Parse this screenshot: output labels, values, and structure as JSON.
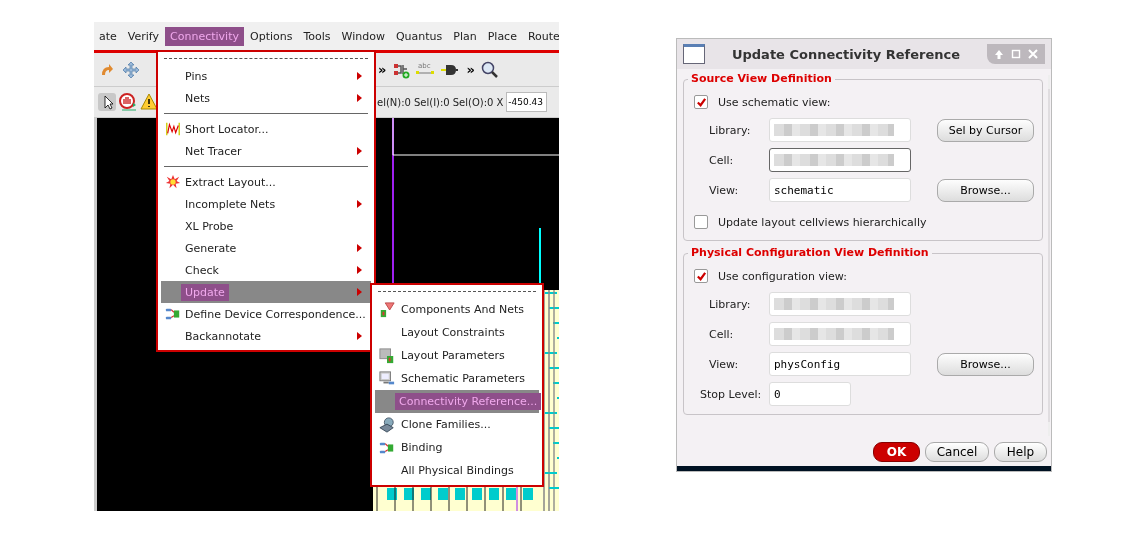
{
  "layout_window": {
    "menu_bar": [
      {
        "label": "ate",
        "selected": false
      },
      {
        "label": "Verify",
        "selected": false
      },
      {
        "label": "Connectivity",
        "selected": true
      },
      {
        "label": "Options",
        "selected": false
      },
      {
        "label": "Tools",
        "selected": false
      },
      {
        "label": "Window",
        "selected": false
      },
      {
        "label": "Quantus",
        "selected": false
      },
      {
        "label": "Plan",
        "selected": false
      },
      {
        "label": "Place",
        "selected": false
      },
      {
        "label": "Route",
        "selected": false
      }
    ],
    "toolbar_1": [
      {
        "kind": "icon"
      },
      {
        "kind": "icon"
      },
      {
        "kind": "more",
        "text": "»"
      },
      {
        "kind": "icon"
      },
      {
        "kind": "icon",
        "text": "abc"
      },
      {
        "kind": "icon"
      },
      {
        "kind": "more",
        "text": "»"
      },
      {
        "kind": "icon"
      }
    ],
    "toolbar_2": [
      {
        "kind": "icon"
      },
      {
        "kind": "icon"
      },
      {
        "kind": "icon"
      },
      {
        "kind": "text",
        "text": "el(N):0"
      },
      {
        "kind": "text",
        "text": "Sel(I):0"
      },
      {
        "kind": "text",
        "text": "Sel(O):0"
      },
      {
        "kind": "text",
        "text": "X"
      },
      {
        "kind": "field",
        "value": "-450.43"
      }
    ],
    "menu": [
      {
        "kind": "tearoff"
      },
      {
        "kind": "item",
        "label": "Pins",
        "submenu": true,
        "selected": false
      },
      {
        "kind": "item",
        "label": "Nets",
        "submenu": true,
        "selected": false
      },
      {
        "kind": "separator"
      },
      {
        "kind": "item",
        "label": "Short Locator...",
        "submenu": false,
        "selected": false
      },
      {
        "kind": "item",
        "label": "Net Tracer",
        "submenu": true,
        "selected": false
      },
      {
        "kind": "separator"
      },
      {
        "kind": "item",
        "label": "Extract Layout...",
        "submenu": false,
        "selected": false
      },
      {
        "kind": "item",
        "label": "Incomplete Nets",
        "submenu": true,
        "selected": false
      },
      {
        "kind": "item",
        "label": "XL Probe",
        "submenu": false,
        "selected": false
      },
      {
        "kind": "item",
        "label": "Generate",
        "submenu": true,
        "selected": false
      },
      {
        "kind": "item",
        "label": "Check",
        "submenu": true,
        "selected": false
      },
      {
        "kind": "item",
        "label": "Update",
        "submenu": true,
        "selected": true
      },
      {
        "kind": "item",
        "label": "Define Device Correspondence...",
        "submenu": false,
        "selected": false
      },
      {
        "kind": "item",
        "label": "Backannotate",
        "submenu": true,
        "selected": false
      }
    ],
    "submenu": [
      {
        "kind": "tearoff"
      },
      {
        "kind": "item",
        "label": "Components And Nets",
        "submenu": false,
        "selected": false
      },
      {
        "kind": "item",
        "label": "Layout Constraints",
        "submenu": false,
        "selected": false
      },
      {
        "kind": "item",
        "label": "Layout Parameters",
        "submenu": false,
        "selected": false
      },
      {
        "kind": "item",
        "label": "Schematic Parameters",
        "submenu": false,
        "selected": false
      },
      {
        "kind": "item",
        "label": "Connectivity Reference...",
        "submenu": false,
        "selected": true
      },
      {
        "kind": "item",
        "label": "Clone Families...",
        "submenu": false,
        "selected": false
      },
      {
        "kind": "item",
        "label": "Binding",
        "submenu": false,
        "selected": false
      },
      {
        "kind": "item",
        "label": "All Physical Bindings",
        "submenu": false,
        "selected": false
      }
    ]
  },
  "dialog": {
    "title": "Update Connectivity Reference",
    "groups": [
      {
        "title": "Source View Definition",
        "use_label": "Use schematic view:",
        "use_checked": true,
        "rows": [
          {
            "label": "Library:",
            "value_hidden": true,
            "button": "Sel by Cursor"
          },
          {
            "label": "Cell:",
            "value_hidden": true,
            "focused": true
          },
          {
            "label": "View:",
            "value": "schematic",
            "button": "Browse..."
          }
        ],
        "extra_label": "Update layout cellviews hierarchically",
        "extra_checked": false
      },
      {
        "title": "Physical Configuration View Definition",
        "use_label": "Use configuration view:",
        "use_checked": true,
        "rows": [
          {
            "label": "Library:",
            "value_hidden": true
          },
          {
            "label": "Cell:",
            "value_hidden": true
          },
          {
            "label": "View:",
            "value": "physConfig",
            "button": "Browse..."
          },
          {
            "label": "Stop Level:",
            "value": "0",
            "short": true
          }
        ]
      }
    ],
    "buttons": [
      {
        "label": "OK",
        "default": true
      },
      {
        "label": "Cancel",
        "default": false
      },
      {
        "label": "Help",
        "default": false
      }
    ]
  }
}
